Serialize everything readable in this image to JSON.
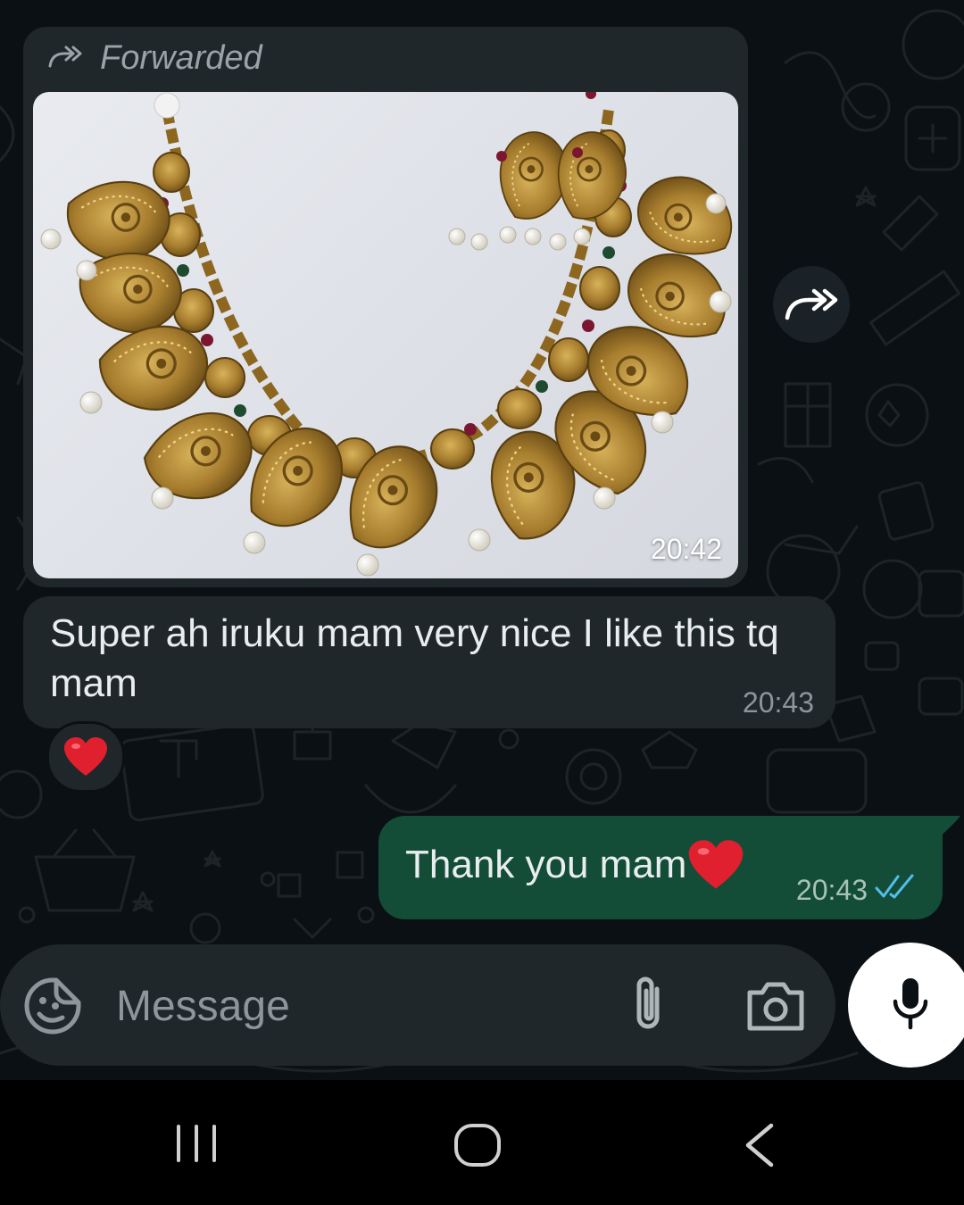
{
  "chat": {
    "forwarded_message": {
      "forwarded_label": "Forwarded",
      "image_alt": "Gold mango-motif necklace with matching earrings",
      "time": "20:42"
    },
    "incoming_message": {
      "text": "Super ah iruku mam very nice I like this tq mam",
      "time": "20:43",
      "reaction": "❤️"
    },
    "outgoing_message": {
      "text": "Thank you mam",
      "emoji": "❤️",
      "time": "20:43",
      "status": "read"
    }
  },
  "input_bar": {
    "placeholder": "Message"
  },
  "icons": {
    "forwarded": "forward-double-arrow-icon",
    "forward_button": "forward-icon",
    "emoji": "sticker-emoji-icon",
    "attach": "paperclip-icon",
    "camera": "camera-icon",
    "mic": "microphone-icon",
    "ticks": "double-check-icon",
    "nav_recent": "recent-apps-icon",
    "nav_home": "home-icon",
    "nav_back": "back-icon"
  },
  "colors": {
    "background": "#0b1014",
    "incoming_bubble": "#1f272a",
    "outgoing_bubble": "#134d37",
    "read_ticks": "#53bdeb",
    "text": "#e9edef",
    "muted": "#8c969b"
  }
}
